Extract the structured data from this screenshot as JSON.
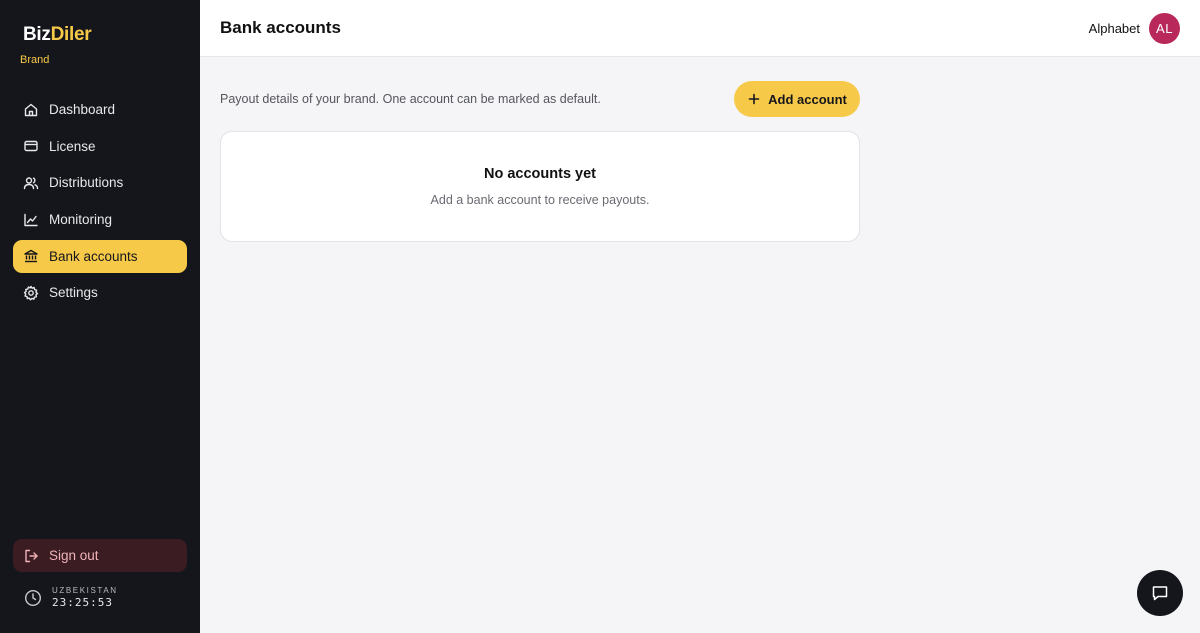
{
  "brand": {
    "name_part1": "Biz",
    "name_part2": "Diler",
    "role": "Brand"
  },
  "sidebar": {
    "items": [
      {
        "label": "Dashboard",
        "icon": "home-icon"
      },
      {
        "label": "License",
        "icon": "card-icon"
      },
      {
        "label": "Distributions",
        "icon": "users-icon"
      },
      {
        "label": "Monitoring",
        "icon": "chart-line-icon"
      },
      {
        "label": "Bank accounts",
        "icon": "bank-icon",
        "active": true
      },
      {
        "label": "Settings",
        "icon": "gear-icon"
      }
    ],
    "signout_label": "Sign out",
    "clock": {
      "region": "UZBEKISTAN",
      "time": "23:25:53"
    }
  },
  "header": {
    "title": "Bank accounts",
    "user_name": "Alphabet",
    "avatar_initials": "AL"
  },
  "main": {
    "description": "Payout details of your brand. One account can be marked as default.",
    "add_button_label": "Add account",
    "empty_state": {
      "title": "No accounts yet",
      "subtitle": "Add a bank account to receive payouts."
    }
  },
  "colors": {
    "accent": "#f7c948",
    "sidebar_bg": "#15161c",
    "avatar_bg": "#b8285a",
    "signout_bg": "#3a1c22"
  }
}
